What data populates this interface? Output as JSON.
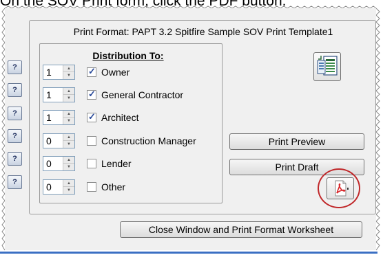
{
  "caption": "On the SOV Print form, click the PDF button.",
  "print_format_label": "Print Format: PAPT 3.2 Spitfire Sample SOV Print Template1",
  "distribution": {
    "title": "Distribution To:",
    "rows": [
      {
        "qty": "1",
        "label": "Owner",
        "checked": true
      },
      {
        "qty": "1",
        "label": "General Contractor",
        "checked": true
      },
      {
        "qty": "1",
        "label": "Architect",
        "checked": true
      },
      {
        "qty": "0",
        "label": "Construction Manager",
        "checked": false
      },
      {
        "qty": "0",
        "label": "Lender",
        "checked": false
      },
      {
        "qty": "0",
        "label": "Other",
        "checked": false
      }
    ]
  },
  "help_label": "?",
  "buttons": {
    "print_preview": "Print Preview",
    "print_draft": "Print Draft",
    "close": "Close Window and Print Format Worksheet"
  },
  "icons": {
    "export": "excel-export-icon",
    "pdf": "pdf-icon"
  },
  "colors": {
    "highlight_circle": "#c0282a",
    "check_mark": "#2a4a9a",
    "pdf_red": "#d8262a"
  }
}
